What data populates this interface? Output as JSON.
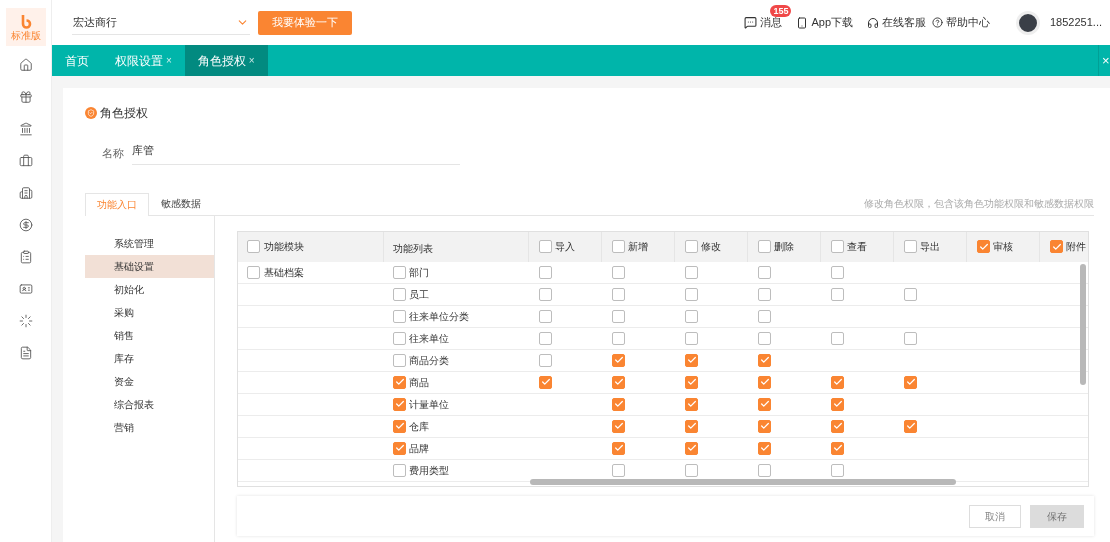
{
  "brand": {
    "edition": "标准版"
  },
  "header": {
    "company": "宏达商行",
    "trial_button": "我要体验一下",
    "messages": {
      "label": "消息",
      "badge": "155"
    },
    "app_download": "App下载",
    "support": "在线客服",
    "help": "帮助中心",
    "user": "1852251..."
  },
  "tabs": [
    {
      "label": "首页",
      "selected": false
    },
    {
      "label": "权限设置",
      "close": "×",
      "selected": false
    },
    {
      "label": "角色授权",
      "close": "×",
      "selected": true
    }
  ],
  "tabbar_close": "×",
  "page": {
    "title": "角色授权",
    "name_label": "名称",
    "name_value": "库管"
  },
  "sub_tabs": [
    {
      "label": "功能入口",
      "selected": true
    },
    {
      "label": "敏感数据",
      "selected": false
    }
  ],
  "hint": "修改角色权限，包含该角色功能权限和敏感数据权限",
  "menu": [
    {
      "label": "系统管理",
      "selected": false
    },
    {
      "label": "基础设置",
      "selected": true
    },
    {
      "label": "初始化",
      "selected": false
    },
    {
      "label": "采购",
      "selected": false
    },
    {
      "label": "销售",
      "selected": false
    },
    {
      "label": "库存",
      "selected": false
    },
    {
      "label": "资金",
      "selected": false
    },
    {
      "label": "综合报表",
      "selected": false
    },
    {
      "label": "营销",
      "selected": false
    }
  ],
  "table": {
    "module_header": {
      "label": "功能模块",
      "checked": false
    },
    "list_header": "功能列表",
    "columns": [
      {
        "label": "导入",
        "checked": false
      },
      {
        "label": "新增",
        "checked": false
      },
      {
        "label": "修改",
        "checked": false
      },
      {
        "label": "删除",
        "checked": false
      },
      {
        "label": "查看",
        "checked": false
      },
      {
        "label": "导出",
        "checked": false
      },
      {
        "label": "审核",
        "checked": true
      },
      {
        "label": "附件",
        "checked": true
      }
    ],
    "rows": [
      {
        "module": {
          "label": "基础档案",
          "checked": false
        },
        "function": {
          "label": "部门",
          "checked": false
        },
        "cells": [
          {
            "kind": "checkbox",
            "checked": false
          },
          {
            "kind": "checkbox",
            "checked": false
          },
          {
            "kind": "checkbox",
            "checked": false
          },
          {
            "kind": "checkbox",
            "checked": false
          },
          {
            "kind": "checkbox",
            "checked": false
          },
          {
            "kind": "blank"
          },
          {
            "kind": "blank"
          },
          {
            "kind": "blank"
          }
        ]
      },
      {
        "function": {
          "label": "员工",
          "checked": false
        },
        "cells": [
          {
            "kind": "checkbox",
            "checked": false
          },
          {
            "kind": "checkbox",
            "checked": false
          },
          {
            "kind": "checkbox",
            "checked": false
          },
          {
            "kind": "checkbox",
            "checked": false
          },
          {
            "kind": "checkbox",
            "checked": false
          },
          {
            "kind": "checkbox",
            "checked": false
          },
          {
            "kind": "blank"
          },
          {
            "kind": "blank"
          }
        ]
      },
      {
        "function": {
          "label": "往来单位分类",
          "checked": false
        },
        "cells": [
          {
            "kind": "checkbox",
            "checked": false
          },
          {
            "kind": "checkbox",
            "checked": false
          },
          {
            "kind": "checkbox",
            "checked": false
          },
          {
            "kind": "checkbox",
            "checked": false
          },
          {
            "kind": "blank"
          },
          {
            "kind": "blank"
          },
          {
            "kind": "blank"
          },
          {
            "kind": "blank"
          }
        ]
      },
      {
        "function": {
          "label": "往来单位",
          "checked": false
        },
        "cells": [
          {
            "kind": "checkbox",
            "checked": false
          },
          {
            "kind": "checkbox",
            "checked": false
          },
          {
            "kind": "checkbox",
            "checked": false
          },
          {
            "kind": "checkbox",
            "checked": false
          },
          {
            "kind": "checkbox",
            "checked": false
          },
          {
            "kind": "checkbox",
            "checked": false
          },
          {
            "kind": "blank"
          },
          {
            "kind": "blank"
          }
        ]
      },
      {
        "function": {
          "label": "商品分类",
          "checked": false
        },
        "cells": [
          {
            "kind": "checkbox",
            "checked": false
          },
          {
            "kind": "checkbox",
            "checked": true
          },
          {
            "kind": "checkbox",
            "checked": true
          },
          {
            "kind": "checkbox",
            "checked": true
          },
          {
            "kind": "blank"
          },
          {
            "kind": "blank"
          },
          {
            "kind": "blank"
          },
          {
            "kind": "blank"
          }
        ]
      },
      {
        "function": {
          "label": "商品",
          "checked": true
        },
        "cells": [
          {
            "kind": "checkbox",
            "checked": true
          },
          {
            "kind": "checkbox",
            "checked": true
          },
          {
            "kind": "checkbox",
            "checked": true
          },
          {
            "kind": "checkbox",
            "checked": true
          },
          {
            "kind": "checkbox",
            "checked": true
          },
          {
            "kind": "checkbox",
            "checked": true
          },
          {
            "kind": "blank"
          },
          {
            "kind": "blank"
          }
        ]
      },
      {
        "function": {
          "label": "计量单位",
          "checked": true
        },
        "cells": [
          {
            "kind": "blank"
          },
          {
            "kind": "checkbox",
            "checked": true
          },
          {
            "kind": "checkbox",
            "checked": true
          },
          {
            "kind": "checkbox",
            "checked": true
          },
          {
            "kind": "checkbox",
            "checked": true
          },
          {
            "kind": "blank"
          },
          {
            "kind": "blank"
          },
          {
            "kind": "blank"
          }
        ]
      },
      {
        "function": {
          "label": "仓库",
          "checked": true
        },
        "cells": [
          {
            "kind": "blank"
          },
          {
            "kind": "checkbox",
            "checked": true
          },
          {
            "kind": "checkbox",
            "checked": true
          },
          {
            "kind": "checkbox",
            "checked": true
          },
          {
            "kind": "checkbox",
            "checked": true
          },
          {
            "kind": "checkbox",
            "checked": true
          },
          {
            "kind": "blank"
          },
          {
            "kind": "blank"
          }
        ]
      },
      {
        "function": {
          "label": "品牌",
          "checked": true
        },
        "cells": [
          {
            "kind": "blank"
          },
          {
            "kind": "checkbox",
            "checked": true
          },
          {
            "kind": "checkbox",
            "checked": true
          },
          {
            "kind": "checkbox",
            "checked": true
          },
          {
            "kind": "checkbox",
            "checked": true
          },
          {
            "kind": "blank"
          },
          {
            "kind": "blank"
          },
          {
            "kind": "blank"
          }
        ]
      },
      {
        "function": {
          "label": "费用类型",
          "checked": false
        },
        "cells": [
          {
            "kind": "blank"
          },
          {
            "kind": "checkbox",
            "checked": false
          },
          {
            "kind": "checkbox",
            "checked": false
          },
          {
            "kind": "checkbox",
            "checked": false
          },
          {
            "kind": "checkbox",
            "checked": false
          },
          {
            "kind": "blank"
          },
          {
            "kind": "blank"
          },
          {
            "kind": "blank"
          }
        ]
      }
    ]
  },
  "footer": {
    "cancel": "取消",
    "save": {
      "label": "保存",
      "disabled": true
    }
  }
}
